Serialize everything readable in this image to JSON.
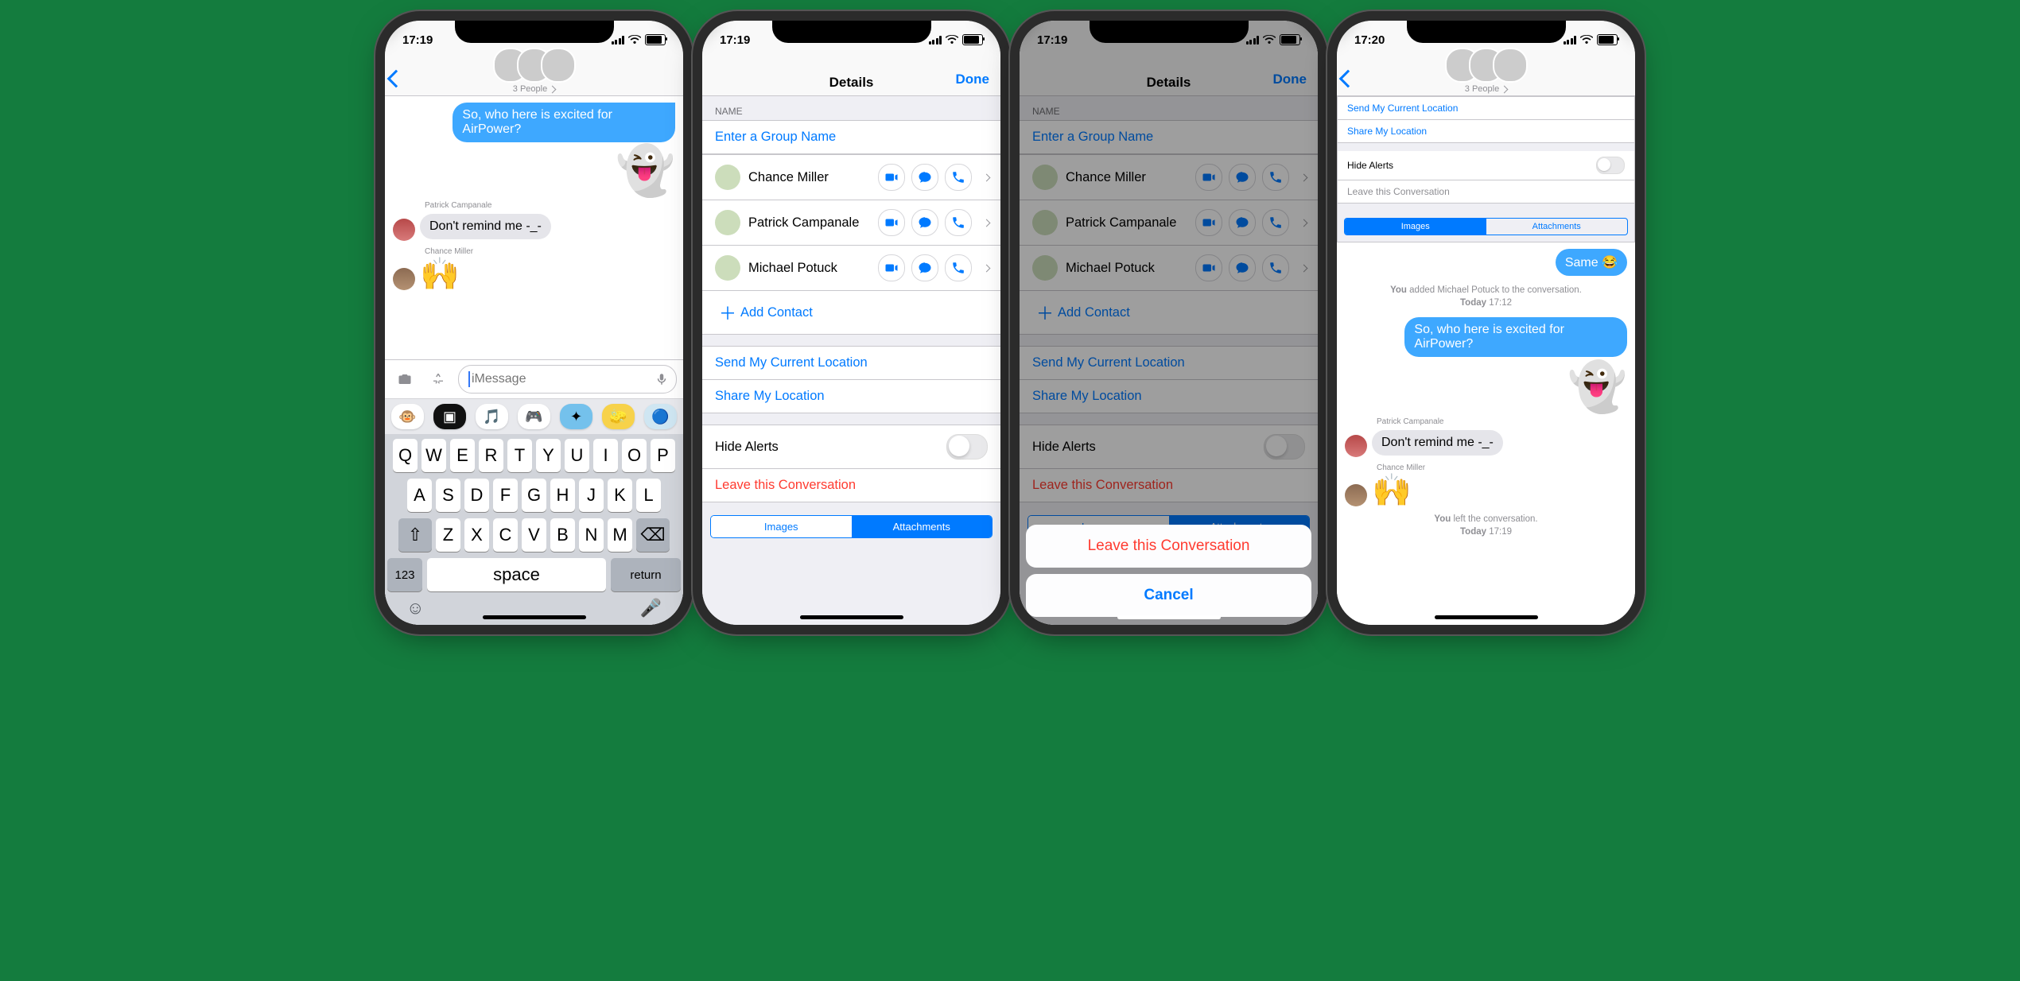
{
  "statusbar": {
    "time_a": "17:19",
    "time_b": "17:19",
    "time_c": "17:19",
    "time_d": "17:20"
  },
  "groupHeader": {
    "subtitle": "3 People"
  },
  "chat1": {
    "banner": "So, who here is excited for AirPower?",
    "sender1": "Patrick Campanale",
    "msg1": "Don't remind me -_-",
    "sender2": "Chance Miller",
    "placeholder": "iMessage"
  },
  "keyboard": {
    "rows": [
      [
        "Q",
        "W",
        "E",
        "R",
        "T",
        "Y",
        "U",
        "I",
        "O",
        "P"
      ],
      [
        "A",
        "S",
        "D",
        "F",
        "G",
        "H",
        "J",
        "K",
        "L"
      ],
      [
        "Z",
        "X",
        "C",
        "V",
        "B",
        "N",
        "M"
      ]
    ],
    "num": "123",
    "space": "space",
    "ret": "return"
  },
  "details": {
    "title": "Details",
    "done": "Done",
    "nameHeader": "NAME",
    "groupPlaceholder": "Enter a Group Name",
    "participants": [
      {
        "name": "Chance Miller"
      },
      {
        "name": "Patrick Campanale"
      },
      {
        "name": "Michael Potuck"
      }
    ],
    "addContact": "Add Contact",
    "sendLocation": "Send My Current Location",
    "shareLocation": "Share My Location",
    "hideAlerts": "Hide Alerts",
    "leave": "Leave this Conversation",
    "segImages": "Images",
    "segAttachments": "Attachments"
  },
  "sheet": {
    "leave": "Leave this Conversation",
    "cancel": "Cancel"
  },
  "chat4": {
    "sameMsg": "Same 😂",
    "sys1_prefix": "You",
    "sys1_text": " added Michael Potuck to the conversation.",
    "sys1_date": "Today",
    "sys1_time": " 17:12",
    "blueMsg": "So, who here is excited for AirPower?",
    "sender1": "Patrick Campanale",
    "msg1": "Don't remind me -_-",
    "sender2": "Chance Miller",
    "sys2_prefix": "You",
    "sys2_text": " left the conversation.",
    "sys2_date": "Today",
    "sys2_time": " 17:19"
  }
}
